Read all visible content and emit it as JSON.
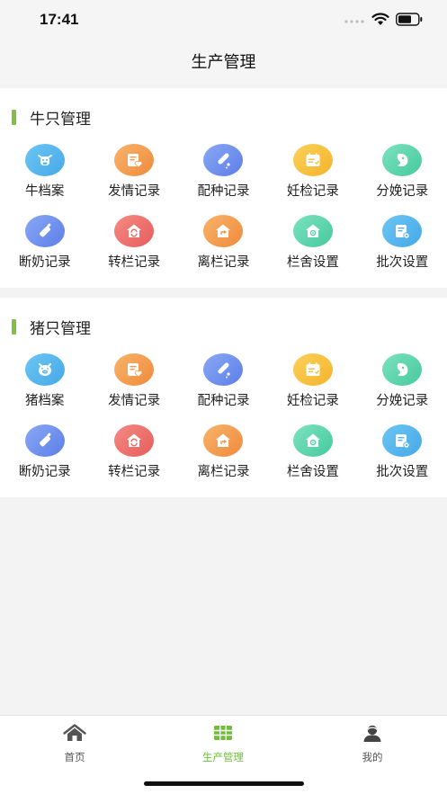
{
  "status_bar": {
    "time": "17:41"
  },
  "nav": {
    "title": "生产管理"
  },
  "sections": {
    "cattle": {
      "title": "牛只管理",
      "items": [
        {
          "label": "牛档案",
          "icon": "cow-icon",
          "color": "#54b2ee"
        },
        {
          "label": "发情记录",
          "icon": "heart-note-icon",
          "color": "#f39a4a"
        },
        {
          "label": "配种记录",
          "icon": "test-tube-icon",
          "color": "#6d8ff0"
        },
        {
          "label": "妊检记录",
          "icon": "calendar-check-icon",
          "color": "#f6c03c"
        },
        {
          "label": "分娩记录",
          "icon": "newborn-icon",
          "color": "#57d1a8"
        },
        {
          "label": "断奶记录",
          "icon": "bottle-icon",
          "color": "#6d8ff0"
        },
        {
          "label": "转栏记录",
          "icon": "house-transfer-icon",
          "color": "#ea6966"
        },
        {
          "label": "离栏记录",
          "icon": "house-exit-icon",
          "color": "#f39a4a"
        },
        {
          "label": "栏舍设置",
          "icon": "house-settings-icon",
          "color": "#57d1a8"
        },
        {
          "label": "批次设置",
          "icon": "batch-settings-icon",
          "color": "#54b2ee"
        }
      ]
    },
    "pig": {
      "title": "猪只管理",
      "items": [
        {
          "label": "猪档案",
          "icon": "pig-icon",
          "color": "#54b2ee"
        },
        {
          "label": "发情记录",
          "icon": "heart-note-icon",
          "color": "#f39a4a"
        },
        {
          "label": "配种记录",
          "icon": "test-tube-icon",
          "color": "#6d8ff0"
        },
        {
          "label": "妊检记录",
          "icon": "calendar-check-icon",
          "color": "#f6c03c"
        },
        {
          "label": "分娩记录",
          "icon": "newborn-icon",
          "color": "#57d1a8"
        },
        {
          "label": "断奶记录",
          "icon": "bottle-icon",
          "color": "#6d8ff0"
        },
        {
          "label": "转栏记录",
          "icon": "house-transfer-icon",
          "color": "#ea6966"
        },
        {
          "label": "离栏记录",
          "icon": "house-exit-icon",
          "color": "#f39a4a"
        },
        {
          "label": "栏舍设置",
          "icon": "house-settings-icon",
          "color": "#57d1a8"
        },
        {
          "label": "批次设置",
          "icon": "batch-settings-icon",
          "color": "#54b2ee"
        }
      ]
    }
  },
  "tab_bar": {
    "active_color": "#6fbf3b",
    "tabs": [
      {
        "label": "首页",
        "icon": "home-icon"
      },
      {
        "label": "生产管理",
        "icon": "grid-icon"
      },
      {
        "label": "我的",
        "icon": "user-icon"
      }
    ]
  }
}
